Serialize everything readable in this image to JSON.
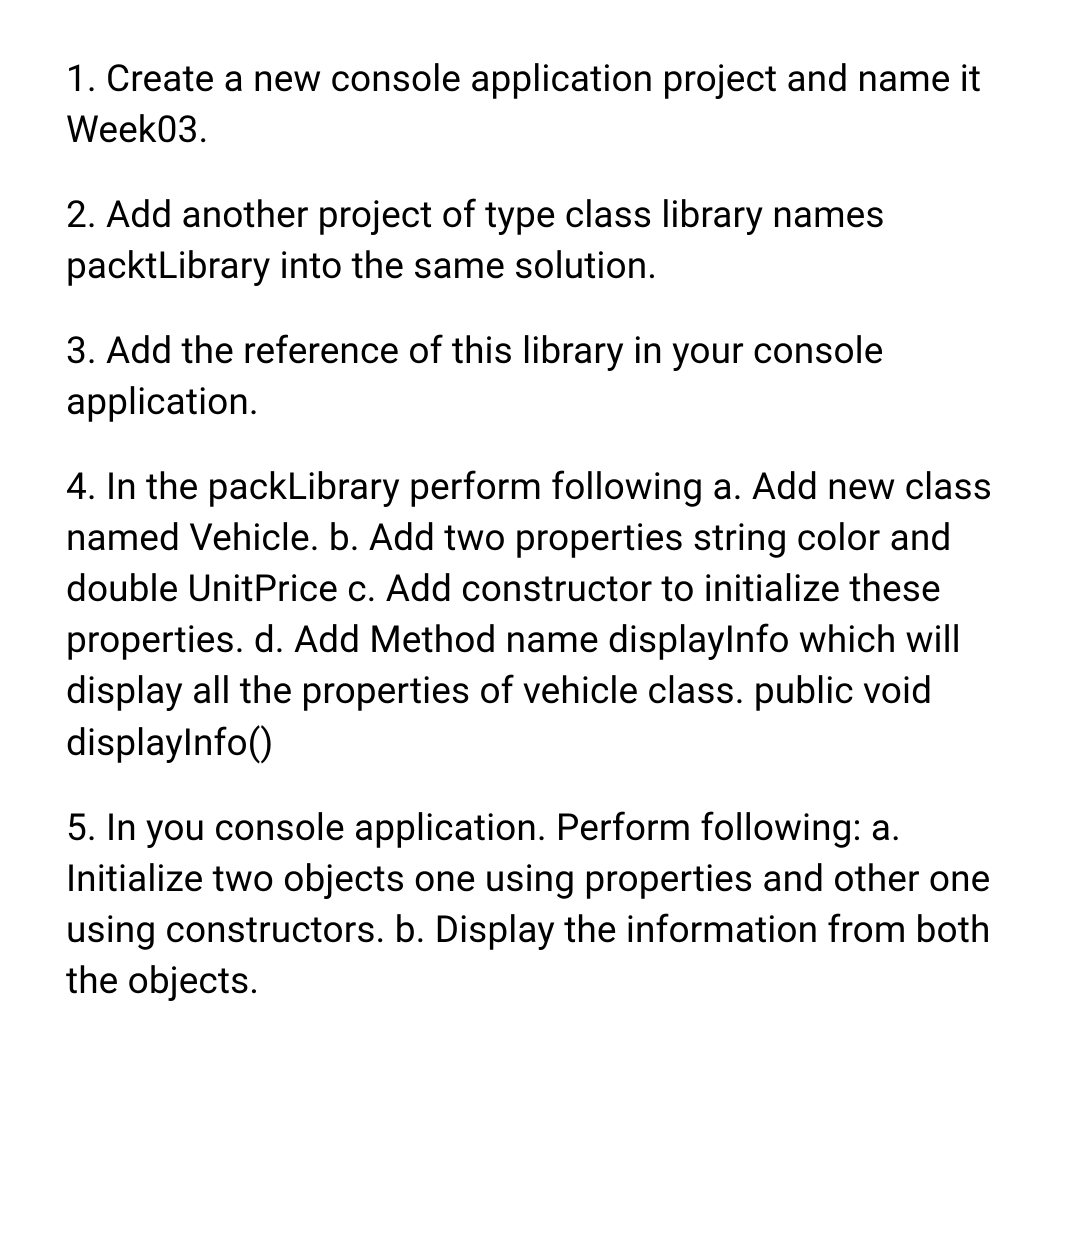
{
  "paragraphs": [
    "1. Create a new console application project and name it Week03.",
    "2. Add another project of type class library names packtLibrary into the same solution.",
    "3. Add the reference of this library in your console application.",
    "4. In the packLibrary perform following a. Add new class named Vehicle. b. Add two properties string color and double UnitPrice c. Add constructor to initialize these properties. d. Add Method name displayInfo which will display all the properties of vehicle class. public void displayInfo()",
    "5. In you console application. Perform following: a. Initialize two objects one using properties and other one using constructors. b. Display the information from both the objects."
  ]
}
